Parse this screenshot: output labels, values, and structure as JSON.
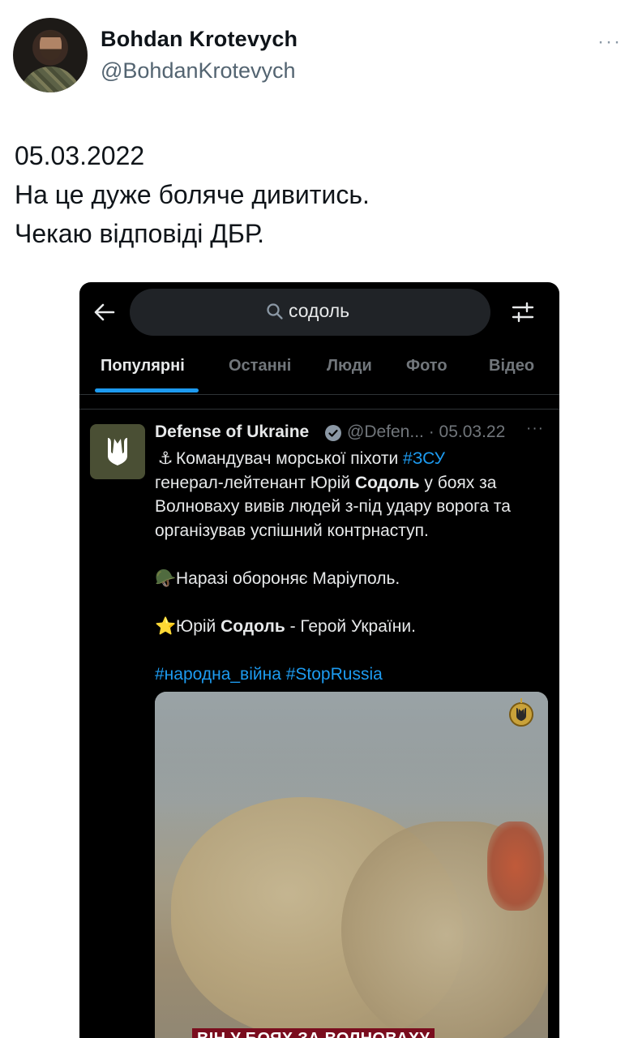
{
  "tweet": {
    "author_name": "Bohdan Krotevych",
    "author_handle": "@BohdanKrotevych",
    "more_label": "···",
    "text_lines": [
      "05.03.2022",
      "На це дуже боляче дивитись.",
      "Чекаю відповіді ДБР."
    ]
  },
  "screenshot": {
    "search": {
      "query": "содоль"
    },
    "tabs": [
      {
        "label": "Популярні",
        "active": true
      },
      {
        "label": "Останні"
      },
      {
        "label": "Люди"
      },
      {
        "label": "Фото"
      },
      {
        "label": "Відео"
      }
    ],
    "post": {
      "author_name": "Defense of Ukraine",
      "handle_date": "@Defen... · 05.03.22",
      "more_label": "···",
      "line1_emoji": "⚓",
      "line1_text": "Командувач морської піхоти ",
      "line1_tag": "#ЗСУ",
      "line2_text": "генерал-лейтенант Юрій ",
      "line2_bold": "Содоль",
      "line2_tail": " у боях за",
      "line3": "Волноваху вивів людей з-під удару ворога та",
      "line4": "організував успішний контрнаступ.",
      "line5_emoji": "🪖",
      "line5_text": "Наразі обороняє Маріуполь.",
      "line6_emoji": "⭐",
      "line6_text": "Юрій ",
      "line6_bold": "Содоль",
      "line6_tail": " - Герой України.",
      "hashtags": "#народна_війна #StopRussia",
      "video_caption": "ВІН У БОЯХ ЗА ВОЛНОВАХУ"
    },
    "colors": {
      "accent": "#1d9bf0",
      "background": "#000000",
      "caption_bg": "#7a0d1e"
    },
    "icons": [
      "back-arrow-icon",
      "search-icon",
      "filter-icon",
      "verified-icon",
      "trident-icon"
    ]
  }
}
